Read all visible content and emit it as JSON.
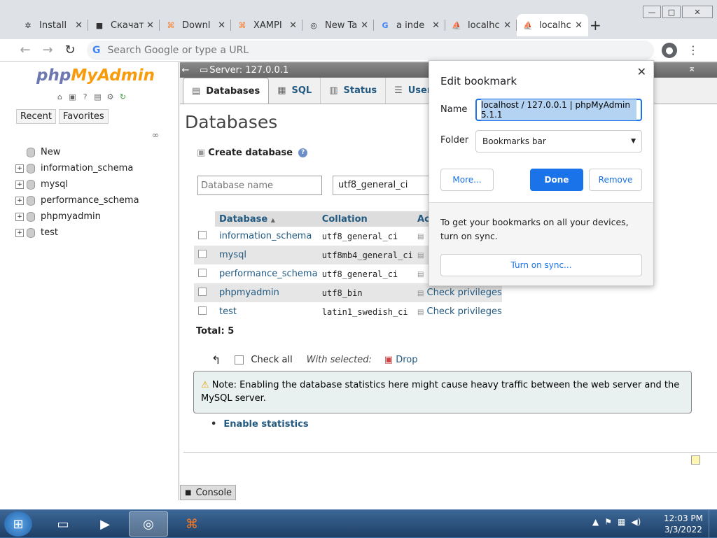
{
  "browser": {
    "tabs": [
      {
        "label": "Install",
        "icon": "gear-icon",
        "glyph": "✲"
      },
      {
        "label": "Скачат",
        "icon": "terminal-icon",
        "glyph": "■"
      },
      {
        "label": "Downl",
        "icon": "xampp-icon",
        "glyph": "⌘"
      },
      {
        "label": "XAMPI",
        "icon": "xampp-icon",
        "glyph": "⌘"
      },
      {
        "label": "New Ta",
        "icon": "chrome-icon",
        "glyph": "◎"
      },
      {
        "label": "a inde",
        "icon": "google-icon",
        "glyph": "G"
      },
      {
        "label": "localhc",
        "icon": "pma-icon",
        "glyph": "⛵"
      },
      {
        "label": "localhc",
        "icon": "pma-icon",
        "glyph": "⛵"
      }
    ],
    "new_tab": "+",
    "omnibox_placeholder": "Search Google or type a URL",
    "window_controls": {
      "min": "—",
      "max": "□",
      "close": "✕"
    }
  },
  "pma": {
    "logo_php": "php",
    "logo_myadmin": "MyAdmin",
    "left_tabs": {
      "recent": "Recent",
      "favorites": "Favorites"
    },
    "tree": [
      {
        "label": "New",
        "expand": ""
      },
      {
        "label": "information_schema",
        "expand": "+"
      },
      {
        "label": "mysql",
        "expand": "+"
      },
      {
        "label": "performance_schema",
        "expand": "+"
      },
      {
        "label": "phpmyadmin",
        "expand": "+"
      },
      {
        "label": "test",
        "expand": "+"
      }
    ],
    "server": "Server: 127.0.0.1",
    "main_tabs": {
      "databases": "Databases",
      "sql": "SQL",
      "status": "Status",
      "users": "User a"
    },
    "page_title": "Databases",
    "create_label": "Create database",
    "dbname_placeholder": "Database name",
    "collation_value": "utf8_general_ci",
    "table": {
      "headers": {
        "database": "Database",
        "collation": "Collation",
        "action": "Actio"
      },
      "rows": [
        {
          "name": "information_schema",
          "collation": "utf8_general_ci",
          "action": ""
        },
        {
          "name": "mysql",
          "collation": "utf8mb4_general_ci",
          "action": ""
        },
        {
          "name": "performance_schema",
          "collation": "utf8_general_ci",
          "action": ""
        },
        {
          "name": "phpmyadmin",
          "collation": "utf8_bin",
          "action": "Check privileges"
        },
        {
          "name": "test",
          "collation": "latin1_swedish_ci",
          "action": "Check privileges"
        }
      ]
    },
    "total": "Total: 5",
    "check_all": "Check all",
    "with_selected": "With selected:",
    "drop": "Drop",
    "note": "Note: Enabling the database statistics here might cause heavy traffic between the web server and the MySQL server.",
    "enable_stats": "Enable statistics",
    "console": "Console"
  },
  "bookmark": {
    "title": "Edit bookmark",
    "name_label": "Name",
    "name_value": "localhost / 127.0.0.1 | phpMyAdmin 5.1.1",
    "folder_label": "Folder",
    "folder_value": "Bookmarks bar",
    "more": "More...",
    "done": "Done",
    "remove": "Remove",
    "sync_text": "To get your bookmarks on all your devices, turn on sync.",
    "sync_button": "Turn on sync..."
  },
  "taskbar": {
    "time": "12:03 PM",
    "date": "3/3/2022"
  },
  "colors": {
    "link": "#235a81",
    "accent": "#1a73e8"
  }
}
